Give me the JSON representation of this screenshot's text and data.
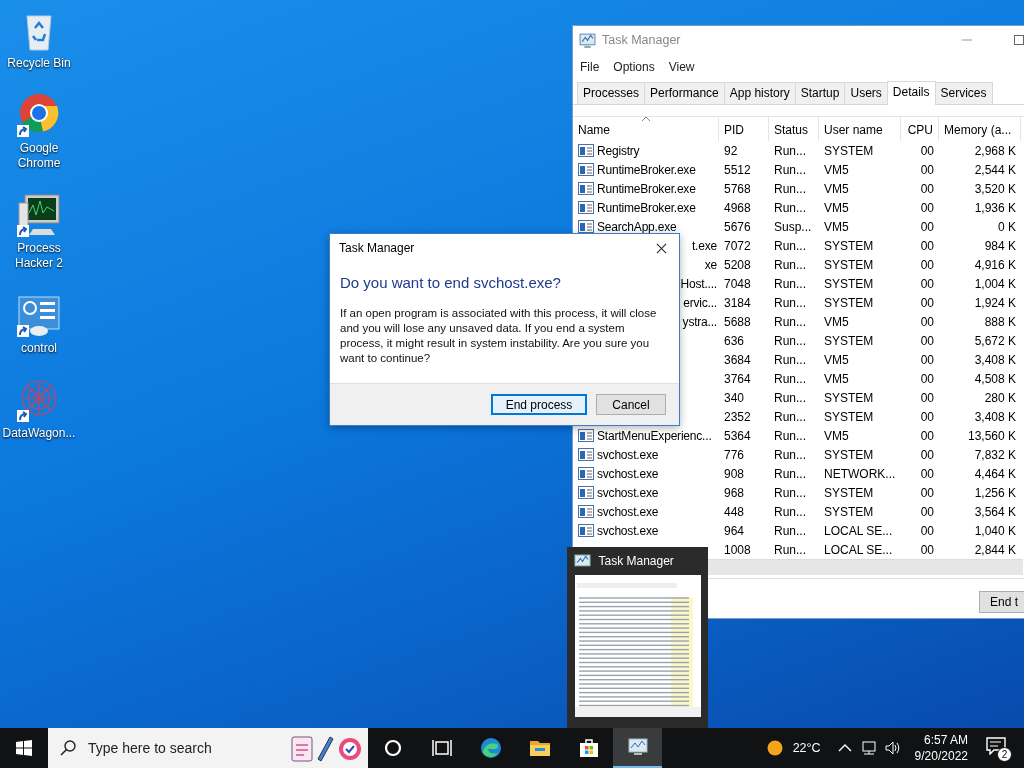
{
  "desktop_icons": [
    {
      "label": "Recycle Bin",
      "kind": "recycle-bin",
      "shortcut": false
    },
    {
      "label": "Google Chrome",
      "kind": "chrome",
      "shortcut": true
    },
    {
      "label": "Process Hacker 2",
      "kind": "monitor",
      "shortcut": true
    },
    {
      "label": "control",
      "kind": "control-panel",
      "shortcut": true
    },
    {
      "label": "DataWagon...",
      "kind": "pattern",
      "shortcut": true
    }
  ],
  "task_manager": {
    "title": "Task Manager",
    "menu": [
      "File",
      "Options",
      "View"
    ],
    "tabs": [
      {
        "label": "Processes",
        "selected": false
      },
      {
        "label": "Performance",
        "selected": false
      },
      {
        "label": "App history",
        "selected": false
      },
      {
        "label": "Startup",
        "selected": false
      },
      {
        "label": "Users",
        "selected": false
      },
      {
        "label": "Details",
        "selected": true
      },
      {
        "label": "Services",
        "selected": false
      }
    ],
    "columns": [
      {
        "label": "Name",
        "sorted": true
      },
      {
        "label": "PID",
        "sorted": false
      },
      {
        "label": "Status",
        "sorted": false
      },
      {
        "label": "User name",
        "sorted": false
      },
      {
        "label": "CPU",
        "sorted": false
      },
      {
        "label": "Memory (a...",
        "sorted": false
      }
    ],
    "rows": [
      {
        "kind": "process",
        "name": "Registry",
        "pid": "92",
        "status": "Run...",
        "user": "SYSTEM",
        "cpu": "00",
        "memory": "2,968 K"
      },
      {
        "kind": "process",
        "name": "RuntimeBroker.exe",
        "pid": "5512",
        "status": "Run...",
        "user": "VM5",
        "cpu": "00",
        "memory": "2,544 K"
      },
      {
        "kind": "process",
        "name": "RuntimeBroker.exe",
        "pid": "5768",
        "status": "Run...",
        "user": "VM5",
        "cpu": "00",
        "memory": "3,520 K"
      },
      {
        "kind": "process",
        "name": "RuntimeBroker.exe",
        "pid": "4968",
        "status": "Run...",
        "user": "VM5",
        "cpu": "00",
        "memory": "1,936 K"
      },
      {
        "kind": "process",
        "name": "SearchApp.exe",
        "pid": "5676",
        "status": "Susp...",
        "user": "VM5",
        "cpu": "00",
        "memory": "0 K"
      },
      {
        "kind": "covered",
        "name": "t.exe",
        "pid": "7072",
        "status": "Run...",
        "user": "SYSTEM",
        "cpu": "00",
        "memory": "984 K"
      },
      {
        "kind": "covered",
        "name": "xe",
        "pid": "5208",
        "status": "Run...",
        "user": "SYSTEM",
        "cpu": "00",
        "memory": "4,916 K"
      },
      {
        "kind": "covered",
        "name": "Host....",
        "pid": "7048",
        "status": "Run...",
        "user": "SYSTEM",
        "cpu": "00",
        "memory": "1,004 K"
      },
      {
        "kind": "covered",
        "name": "ervic...",
        "pid": "3184",
        "status": "Run...",
        "user": "SYSTEM",
        "cpu": "00",
        "memory": "1,924 K"
      },
      {
        "kind": "covered",
        "name": "ystra...",
        "pid": "5688",
        "status": "Run...",
        "user": "VM5",
        "cpu": "00",
        "memory": "888 K"
      },
      {
        "kind": "covered",
        "pid": "636",
        "status": "Run...",
        "user": "SYSTEM",
        "cpu": "00",
        "memory": "5,672 K"
      },
      {
        "kind": "covered",
        "pid": "3684",
        "status": "Run...",
        "user": "VM5",
        "cpu": "00",
        "memory": "3,408 K"
      },
      {
        "kind": "covered",
        "pid": "3764",
        "status": "Run...",
        "user": "VM5",
        "cpu": "00",
        "memory": "4,508 K"
      },
      {
        "kind": "covered",
        "pid": "340",
        "status": "Run...",
        "user": "SYSTEM",
        "cpu": "00",
        "memory": "280 K"
      },
      {
        "kind": "covered",
        "pid": "2352",
        "status": "Run...",
        "user": "SYSTEM",
        "cpu": "00",
        "memory": "3,408 K"
      },
      {
        "kind": "process",
        "name": "StartMenuExperienc...",
        "pid": "5364",
        "status": "Run...",
        "user": "VM5",
        "cpu": "00",
        "memory": "13,560 K"
      },
      {
        "kind": "process",
        "name": "svchost.exe",
        "pid": "776",
        "status": "Run...",
        "user": "SYSTEM",
        "cpu": "00",
        "memory": "7,832 K"
      },
      {
        "kind": "process",
        "name": "svchost.exe",
        "pid": "908",
        "status": "Run...",
        "user": "NETWORK...",
        "cpu": "00",
        "memory": "4,464 K"
      },
      {
        "kind": "process",
        "name": "svchost.exe",
        "pid": "968",
        "status": "Run...",
        "user": "SYSTEM",
        "cpu": "00",
        "memory": "1,256 K"
      },
      {
        "kind": "process",
        "name": "svchost.exe",
        "pid": "448",
        "status": "Run...",
        "user": "SYSTEM",
        "cpu": "00",
        "memory": "3,564 K"
      },
      {
        "kind": "process",
        "name": "svchost.exe",
        "pid": "964",
        "status": "Run...",
        "user": "LOCAL SE...",
        "cpu": "00",
        "memory": "1,040 K"
      },
      {
        "kind": "covered",
        "pid": "1008",
        "status": "Run...",
        "user": "LOCAL SE...",
        "cpu": "00",
        "memory": "2,844 K"
      }
    ],
    "footer_button": "End t"
  },
  "dialog": {
    "title": "Task Manager",
    "heading": "Do you want to end svchost.exe?",
    "message": "If an open program is associated with this process, it will close and you will lose any unsaved data. If you end a system process, it might result in system instability. Are you sure you want to continue?",
    "buttons": [
      {
        "label": "End process",
        "focused": true
      },
      {
        "label": "Cancel",
        "focused": false
      }
    ]
  },
  "preview": {
    "title": "Task Manager"
  },
  "taskbar": {
    "search_placeholder": "Type here to search",
    "apps": [
      {
        "kind": "cortana",
        "active": false
      },
      {
        "kind": "task-view",
        "active": false
      },
      {
        "kind": "browser",
        "active": false
      },
      {
        "kind": "folder",
        "active": false
      },
      {
        "kind": "store",
        "active": false
      },
      {
        "kind": "task-manager",
        "active": true
      }
    ],
    "temperature": "22°C",
    "time": "6:57 AM",
    "date": "9/20/2022",
    "notification_count": "2"
  }
}
